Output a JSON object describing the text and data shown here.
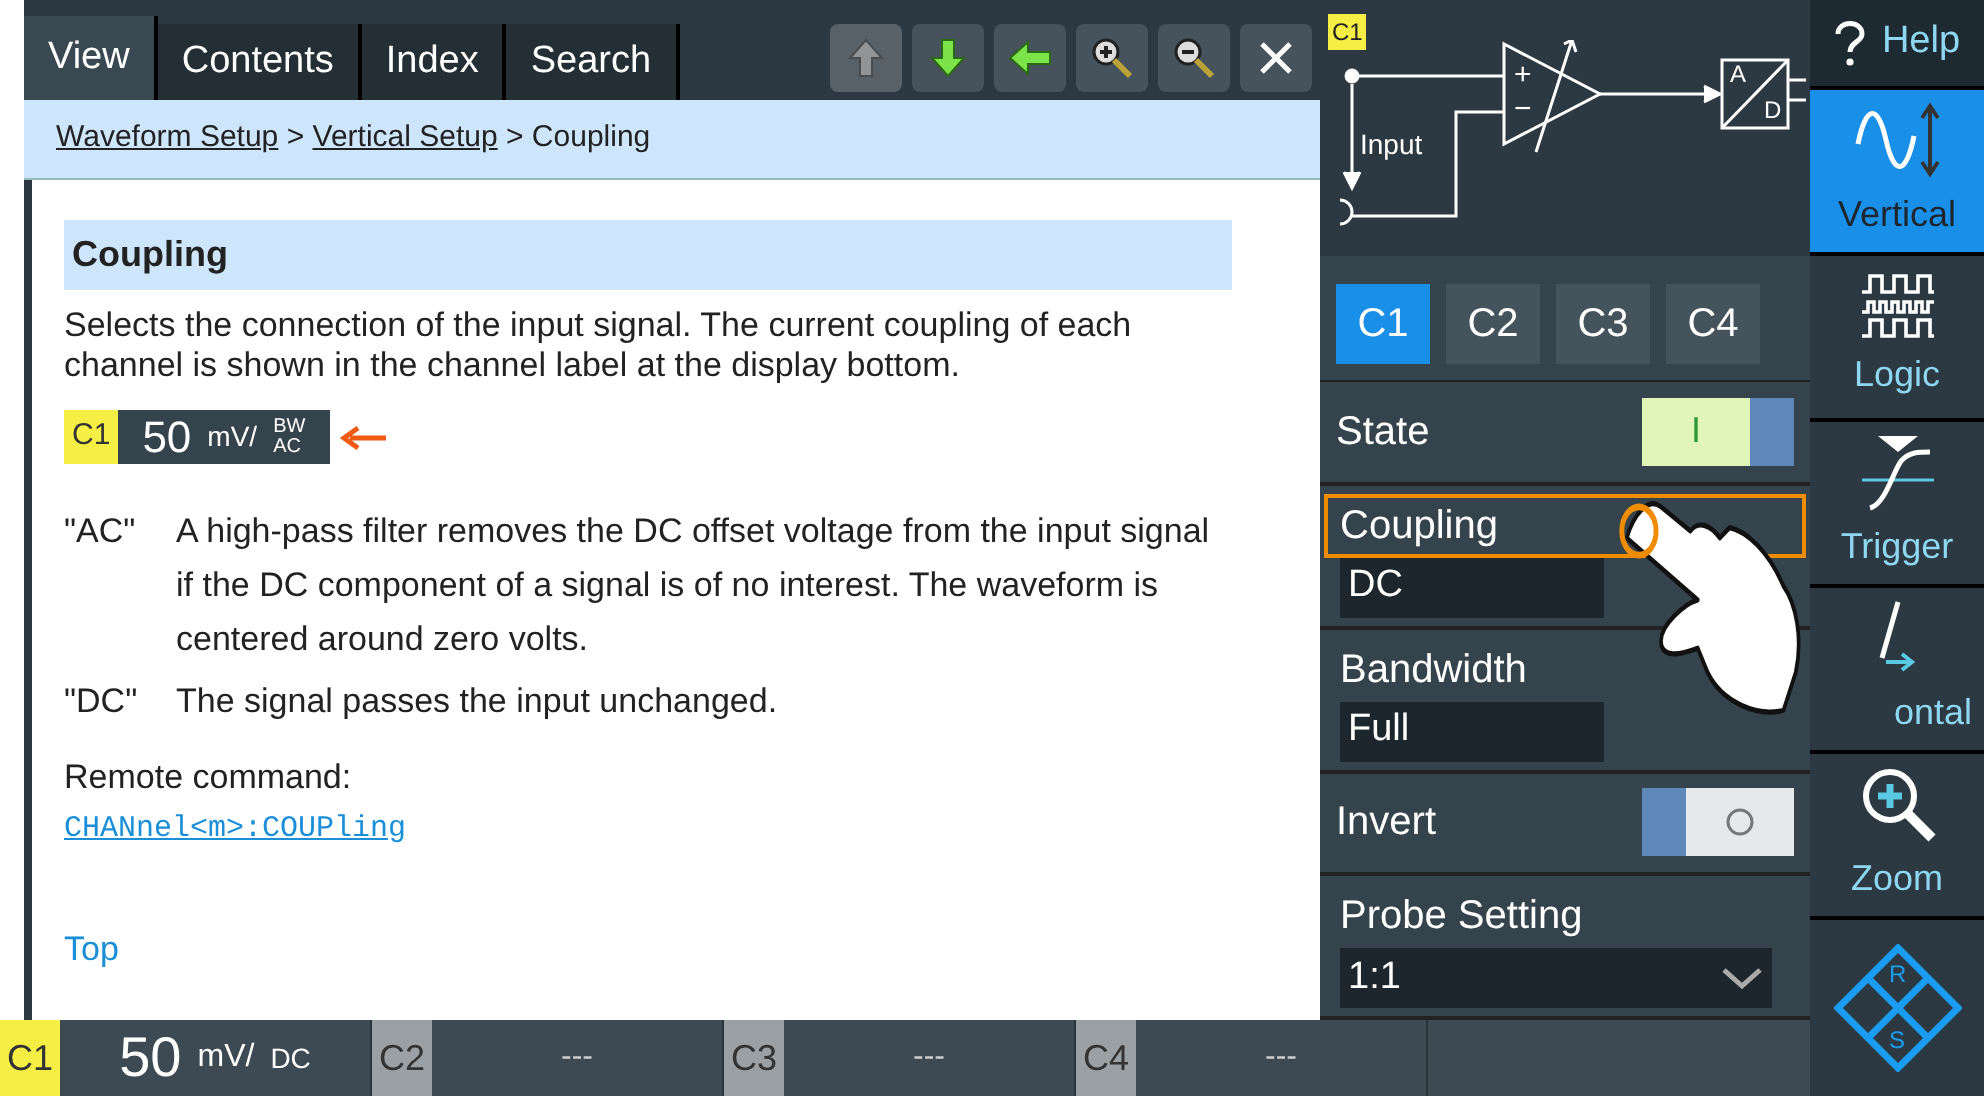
{
  "help_tabs": [
    {
      "label": "View",
      "selected": true
    },
    {
      "label": "Contents",
      "selected": false
    },
    {
      "label": "Index",
      "selected": false
    },
    {
      "label": "Search",
      "selected": false
    }
  ],
  "toolbar": [
    {
      "kind": "up",
      "disabled": true
    },
    {
      "kind": "down",
      "disabled": false
    },
    {
      "kind": "back",
      "disabled": false
    },
    {
      "kind": "zoom_in",
      "disabled": false
    },
    {
      "kind": "zoom_out",
      "disabled": false
    },
    {
      "kind": "close",
      "disabled": false
    }
  ],
  "breadcrumb": [
    {
      "label": "Waveform Setup",
      "link": true
    },
    {
      "label": " > ",
      "link": false
    },
    {
      "label": "Vertical Setup",
      "link": true
    },
    {
      "label": " > Coupling",
      "link": false
    }
  ],
  "heading": "Coupling",
  "intro": "Selects the connection of the input signal. The current coupling of each channel is shown in the channel label at the display bottom.",
  "example_label": {
    "channel": "C1",
    "scale": "50",
    "unit": "mV/",
    "bw": "BW",
    "coupling": "AC"
  },
  "definitions": [
    {
      "term": "\"AC\"",
      "text": "A high-pass filter removes the DC offset voltage from the input signal if the DC component of a signal is of no interest. The waveform is centered around zero volts."
    },
    {
      "term": "\"DC\"",
      "text": "The signal passes the input unchanged."
    }
  ],
  "remote_label": "Remote command:",
  "remote_command": "CHANnel<m>:COUPling",
  "top_link": "Top",
  "diagram": {
    "channel": "C1",
    "input_label": "Input",
    "adc_a": "A",
    "adc_d": "D",
    "plus": "+",
    "minus": "−"
  },
  "channels": [
    {
      "label": "C1",
      "selected": true
    },
    {
      "label": "C2",
      "selected": false
    },
    {
      "label": "C3",
      "selected": false
    },
    {
      "label": "C4",
      "selected": false
    }
  ],
  "settings": [
    {
      "kind": "toggle",
      "label": "State",
      "on": true,
      "toggle_text": "I"
    },
    {
      "kind": "select",
      "label": "Coupling",
      "value": "DC",
      "focused": true,
      "chevron": false
    },
    {
      "kind": "select",
      "label": "Bandwidth",
      "value": "Full",
      "focused": false,
      "chevron": false
    },
    {
      "kind": "toggle",
      "label": "Invert",
      "on": false
    },
    {
      "kind": "select",
      "label": "Probe Setting",
      "value": "1:1",
      "focused": false,
      "chevron": true
    }
  ],
  "sidebar": [
    {
      "kind": "help",
      "label": "Help",
      "selected": false
    },
    {
      "kind": "vertical",
      "label": "Vertical",
      "selected": true
    },
    {
      "kind": "logic",
      "label": "Logic",
      "selected": false
    },
    {
      "kind": "trigger",
      "label": "Trigger",
      "selected": false
    },
    {
      "kind": "horizontal",
      "label": "ontal",
      "selected": false
    },
    {
      "kind": "zoom",
      "label": "Zoom",
      "selected": false
    }
  ],
  "status_channels": [
    {
      "label": "C1",
      "active": true,
      "scale": "50",
      "unit": "mV/",
      "coupling": "DC"
    },
    {
      "label": "C2",
      "active": false,
      "value": "---"
    },
    {
      "label": "C3",
      "active": false,
      "value": "---"
    },
    {
      "label": "C4",
      "active": false,
      "value": "---"
    }
  ],
  "logo": {
    "r": "R",
    "s": "S"
  }
}
